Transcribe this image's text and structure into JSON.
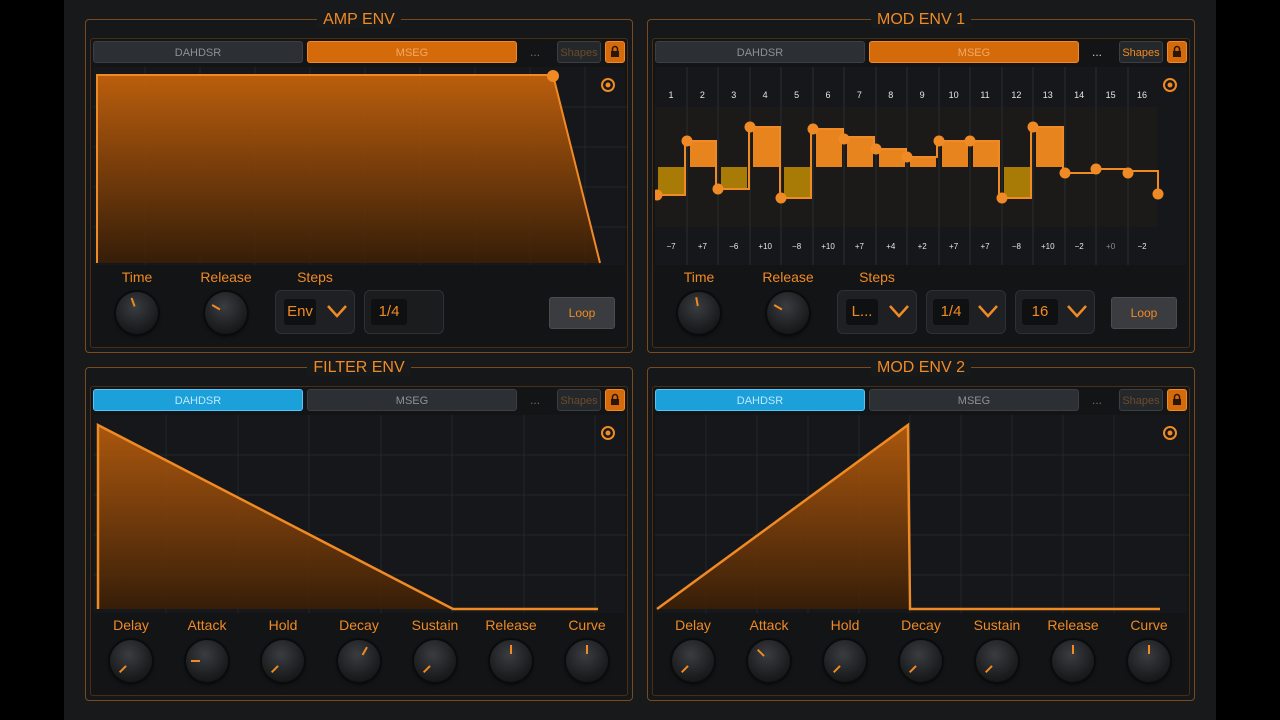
{
  "panels": {
    "amp": {
      "title": "AMP ENV",
      "tab_dahdsr": "DAHDSR",
      "tab_mseg": "MSEG",
      "dots": "...",
      "shapes": "Shapes",
      "controls": {
        "time": "Time",
        "release": "Release",
        "steps": "Steps",
        "steps_value": "Env",
        "rate_value": "1/4",
        "loop": "Loop"
      }
    },
    "mod1": {
      "title": "MOD ENV 1",
      "tab_dahdsr": "DAHDSR",
      "tab_mseg": "MSEG",
      "dots": "...",
      "shapes": "Shapes",
      "controls": {
        "time": "Time",
        "release": "Release",
        "steps": "Steps",
        "steps_value": "L...",
        "rate_value": "1/4",
        "count_value": "16",
        "loop": "Loop"
      },
      "step_numbers": [
        "1",
        "2",
        "3",
        "4",
        "5",
        "6",
        "7",
        "8",
        "9",
        "10",
        "11",
        "12",
        "13",
        "14",
        "15",
        "16"
      ],
      "step_values": [
        "−7",
        "+7",
        "−6",
        "+10",
        "−8",
        "+10",
        "+7",
        "+4",
        "+2",
        "+7",
        "+7",
        "−8",
        "+10",
        "−2",
        "+0",
        "−2"
      ]
    },
    "filter": {
      "title": "FILTER ENV",
      "tab_dahdsr": "DAHDSR",
      "tab_mseg": "MSEG",
      "dots": "...",
      "shapes": "Shapes",
      "knobs": [
        "Delay",
        "Attack",
        "Hold",
        "Decay",
        "Sustain",
        "Release",
        "Curve"
      ]
    },
    "mod2": {
      "title": "MOD ENV 2",
      "tab_dahdsr": "DAHDSR",
      "tab_mseg": "MSEG",
      "dots": "...",
      "shapes": "Shapes",
      "knobs": [
        "Delay",
        "Attack",
        "Hold",
        "Decay",
        "Sustain",
        "Release",
        "Curve"
      ]
    }
  },
  "colors": {
    "accent": "#f08a24",
    "mseg_active": "#d46a0a",
    "dahdsr_active": "#1ba0d9",
    "background": "#17191b"
  }
}
